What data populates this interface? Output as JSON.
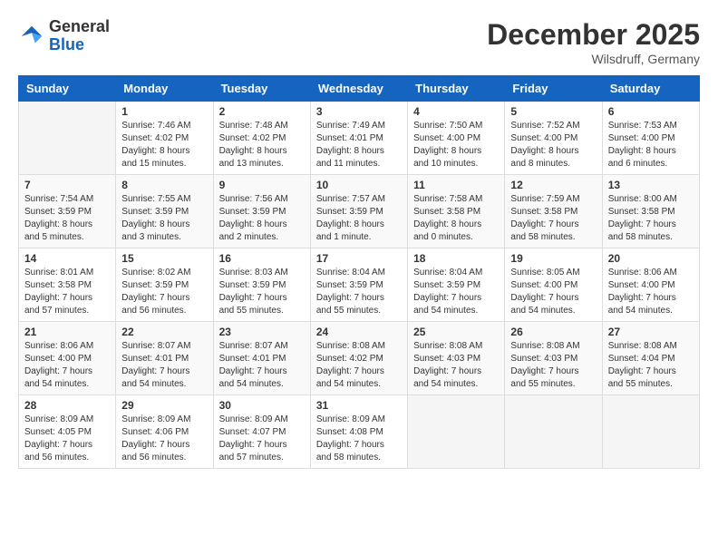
{
  "header": {
    "logo_general": "General",
    "logo_blue": "Blue",
    "month_year": "December 2025",
    "location": "Wilsdruff, Germany"
  },
  "weekdays": [
    "Sunday",
    "Monday",
    "Tuesday",
    "Wednesday",
    "Thursday",
    "Friday",
    "Saturday"
  ],
  "weeks": [
    [
      {
        "day": "",
        "info": ""
      },
      {
        "day": "1",
        "info": "Sunrise: 7:46 AM\nSunset: 4:02 PM\nDaylight: 8 hours\nand 15 minutes."
      },
      {
        "day": "2",
        "info": "Sunrise: 7:48 AM\nSunset: 4:02 PM\nDaylight: 8 hours\nand 13 minutes."
      },
      {
        "day": "3",
        "info": "Sunrise: 7:49 AM\nSunset: 4:01 PM\nDaylight: 8 hours\nand 11 minutes."
      },
      {
        "day": "4",
        "info": "Sunrise: 7:50 AM\nSunset: 4:00 PM\nDaylight: 8 hours\nand 10 minutes."
      },
      {
        "day": "5",
        "info": "Sunrise: 7:52 AM\nSunset: 4:00 PM\nDaylight: 8 hours\nand 8 minutes."
      },
      {
        "day": "6",
        "info": "Sunrise: 7:53 AM\nSunset: 4:00 PM\nDaylight: 8 hours\nand 6 minutes."
      }
    ],
    [
      {
        "day": "7",
        "info": "Sunrise: 7:54 AM\nSunset: 3:59 PM\nDaylight: 8 hours\nand 5 minutes."
      },
      {
        "day": "8",
        "info": "Sunrise: 7:55 AM\nSunset: 3:59 PM\nDaylight: 8 hours\nand 3 minutes."
      },
      {
        "day": "9",
        "info": "Sunrise: 7:56 AM\nSunset: 3:59 PM\nDaylight: 8 hours\nand 2 minutes."
      },
      {
        "day": "10",
        "info": "Sunrise: 7:57 AM\nSunset: 3:59 PM\nDaylight: 8 hours\nand 1 minute."
      },
      {
        "day": "11",
        "info": "Sunrise: 7:58 AM\nSunset: 3:58 PM\nDaylight: 8 hours\nand 0 minutes."
      },
      {
        "day": "12",
        "info": "Sunrise: 7:59 AM\nSunset: 3:58 PM\nDaylight: 7 hours\nand 58 minutes."
      },
      {
        "day": "13",
        "info": "Sunrise: 8:00 AM\nSunset: 3:58 PM\nDaylight: 7 hours\nand 58 minutes."
      }
    ],
    [
      {
        "day": "14",
        "info": "Sunrise: 8:01 AM\nSunset: 3:58 PM\nDaylight: 7 hours\nand 57 minutes."
      },
      {
        "day": "15",
        "info": "Sunrise: 8:02 AM\nSunset: 3:59 PM\nDaylight: 7 hours\nand 56 minutes."
      },
      {
        "day": "16",
        "info": "Sunrise: 8:03 AM\nSunset: 3:59 PM\nDaylight: 7 hours\nand 55 minutes."
      },
      {
        "day": "17",
        "info": "Sunrise: 8:04 AM\nSunset: 3:59 PM\nDaylight: 7 hours\nand 55 minutes."
      },
      {
        "day": "18",
        "info": "Sunrise: 8:04 AM\nSunset: 3:59 PM\nDaylight: 7 hours\nand 54 minutes."
      },
      {
        "day": "19",
        "info": "Sunrise: 8:05 AM\nSunset: 4:00 PM\nDaylight: 7 hours\nand 54 minutes."
      },
      {
        "day": "20",
        "info": "Sunrise: 8:06 AM\nSunset: 4:00 PM\nDaylight: 7 hours\nand 54 minutes."
      }
    ],
    [
      {
        "day": "21",
        "info": "Sunrise: 8:06 AM\nSunset: 4:00 PM\nDaylight: 7 hours\nand 54 minutes."
      },
      {
        "day": "22",
        "info": "Sunrise: 8:07 AM\nSunset: 4:01 PM\nDaylight: 7 hours\nand 54 minutes."
      },
      {
        "day": "23",
        "info": "Sunrise: 8:07 AM\nSunset: 4:01 PM\nDaylight: 7 hours\nand 54 minutes."
      },
      {
        "day": "24",
        "info": "Sunrise: 8:08 AM\nSunset: 4:02 PM\nDaylight: 7 hours\nand 54 minutes."
      },
      {
        "day": "25",
        "info": "Sunrise: 8:08 AM\nSunset: 4:03 PM\nDaylight: 7 hours\nand 54 minutes."
      },
      {
        "day": "26",
        "info": "Sunrise: 8:08 AM\nSunset: 4:03 PM\nDaylight: 7 hours\nand 55 minutes."
      },
      {
        "day": "27",
        "info": "Sunrise: 8:08 AM\nSunset: 4:04 PM\nDaylight: 7 hours\nand 55 minutes."
      }
    ],
    [
      {
        "day": "28",
        "info": "Sunrise: 8:09 AM\nSunset: 4:05 PM\nDaylight: 7 hours\nand 56 minutes."
      },
      {
        "day": "29",
        "info": "Sunrise: 8:09 AM\nSunset: 4:06 PM\nDaylight: 7 hours\nand 56 minutes."
      },
      {
        "day": "30",
        "info": "Sunrise: 8:09 AM\nSunset: 4:07 PM\nDaylight: 7 hours\nand 57 minutes."
      },
      {
        "day": "31",
        "info": "Sunrise: 8:09 AM\nSunset: 4:08 PM\nDaylight: 7 hours\nand 58 minutes."
      },
      {
        "day": "",
        "info": ""
      },
      {
        "day": "",
        "info": ""
      },
      {
        "day": "",
        "info": ""
      }
    ]
  ]
}
